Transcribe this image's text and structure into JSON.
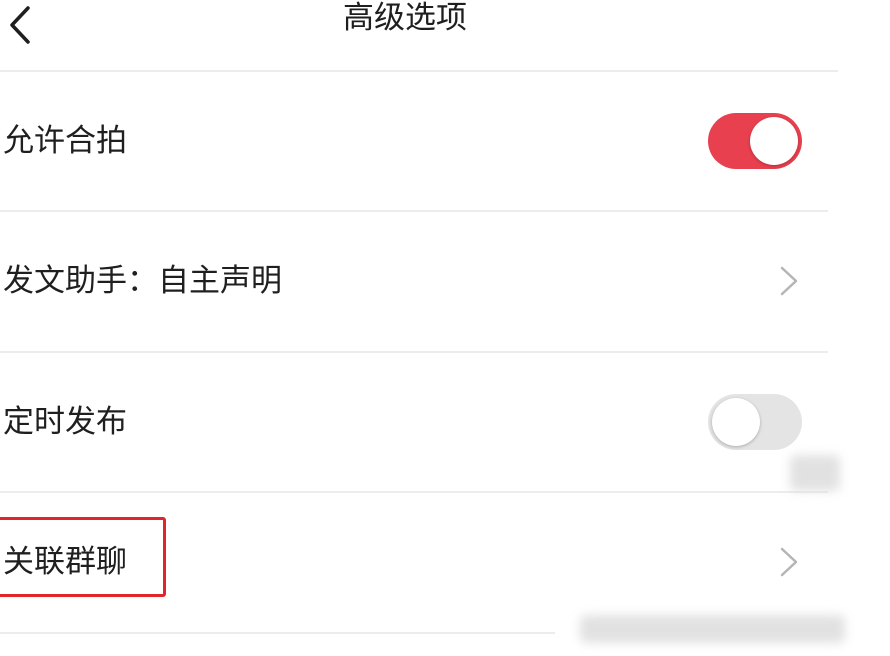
{
  "header": {
    "title": "高级选项",
    "back_icon": "chevron-left-icon"
  },
  "options": [
    {
      "label": "允许合拍",
      "control": "toggle",
      "state": "on"
    },
    {
      "label": "发文助手：自主声明",
      "control": "chevron"
    },
    {
      "label": "定时发布",
      "control": "toggle",
      "state": "off"
    },
    {
      "label": "关联群聊",
      "control": "chevron",
      "highlighted": true
    }
  ],
  "colors": {
    "toggle_on": "#e8404e",
    "toggle_off": "#e4e4e4",
    "highlight_border": "#e0252b",
    "divider": "#ececec",
    "chevron": "#b5b5b5"
  }
}
